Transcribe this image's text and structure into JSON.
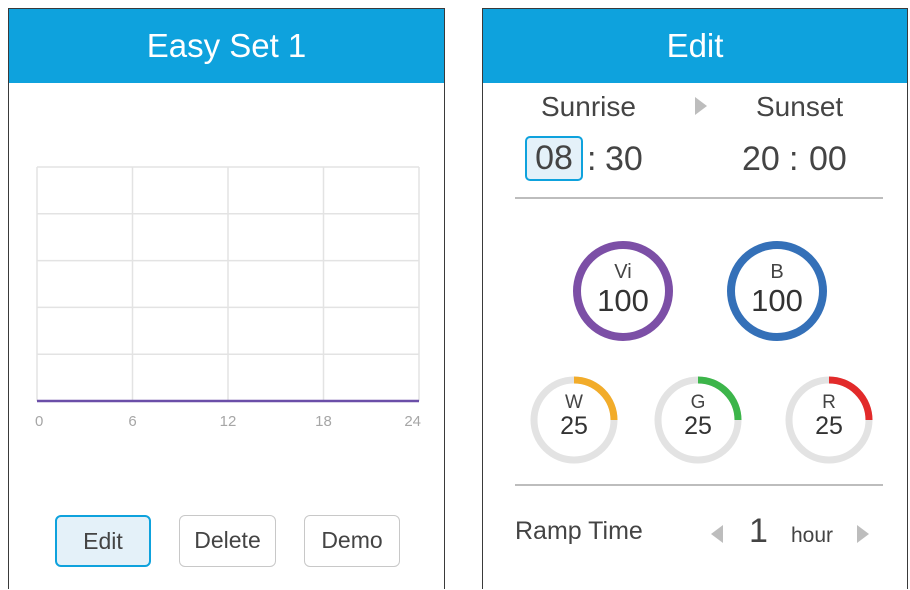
{
  "easy_set": {
    "title": "Easy Set 1",
    "chart_data": {
      "type": "line",
      "x": [
        0,
        24
      ],
      "series": [
        {
          "values": [
            0,
            0
          ],
          "color": "#6b4fa8"
        }
      ],
      "xticks": [
        "0",
        "6",
        "12",
        "18",
        "24"
      ],
      "xlim": [
        0,
        24
      ],
      "grid": true
    },
    "buttons": {
      "edit": "Edit",
      "delete": "Delete",
      "demo": "Demo"
    }
  },
  "edit_panel": {
    "title": "Edit",
    "sunrise_label": "Sunrise",
    "sunset_label": "Sunset",
    "sunrise_hour": "08",
    "sunrise_minute": "30",
    "sunset_hour": "20",
    "sunset_minute": "00",
    "separator": ":",
    "channels_large": [
      {
        "name": "Vi",
        "value": "100",
        "color": "#7c4fa6"
      },
      {
        "name": "B",
        "value": "100",
        "color": "#3470b8"
      }
    ],
    "channels_small": [
      {
        "name": "W",
        "value": "25",
        "color": "#f2ac2a",
        "fraction": 0.25
      },
      {
        "name": "G",
        "value": "25",
        "color": "#3cb54a",
        "fraction": 0.25
      },
      {
        "name": "R",
        "value": "25",
        "color": "#e22a2a",
        "fraction": 0.25
      }
    ],
    "ramp_label": "Ramp Time",
    "ramp_value": "1",
    "ramp_unit": "hour"
  }
}
